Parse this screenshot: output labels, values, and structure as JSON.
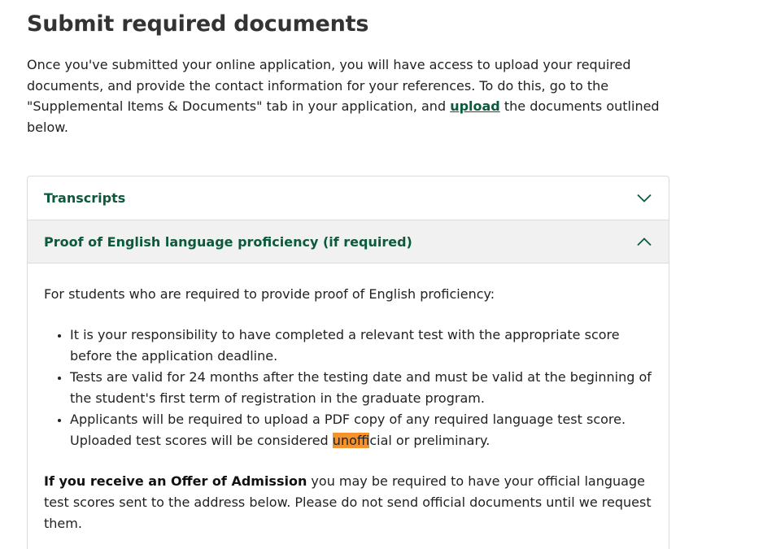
{
  "title": "Submit required documents",
  "intro": {
    "before_link": "Once you've submitted your online application, you will have access to upload your required documents, and provide the contact information for your references. To do this, go to the \"Supplemental Items & Documents\" tab in your application, and ",
    "link": "upload",
    "after_link": " the documents outlined below."
  },
  "accordion": {
    "items": [
      {
        "label": "Transcripts",
        "state": "collapsed",
        "icon": "chevron-down-icon"
      },
      {
        "label": "Proof of English language proficiency (if required)",
        "state": "expanded",
        "icon": "chevron-up-icon"
      }
    ],
    "body": {
      "lead": "For students who are required to provide proof of English proficiency:",
      "bullets": [
        "It is your responsibility to have completed a relevant test with the appropriate score before the application deadline.",
        "Tests are valid for 24 months after the testing date and must be valid at the beginning of the student's first term of registration in the graduate program."
      ],
      "bullet3_before": "Applicants will be required to upload a PDF copy of any required language test score. Uploaded test scores will be considered ",
      "bullet3_highlight": "unoff",
      "bullet3_after": "icial or preliminary.",
      "offer_bold": "If you receive an Offer of Admission",
      "offer_rest": " you may be required to have your official language test scores sent to the address below. Please do not send official documents until we request them."
    }
  },
  "colors": {
    "accent": "#0b5a3c",
    "highlight": "#f6922b",
    "header_bg": "#f0f1f0"
  }
}
